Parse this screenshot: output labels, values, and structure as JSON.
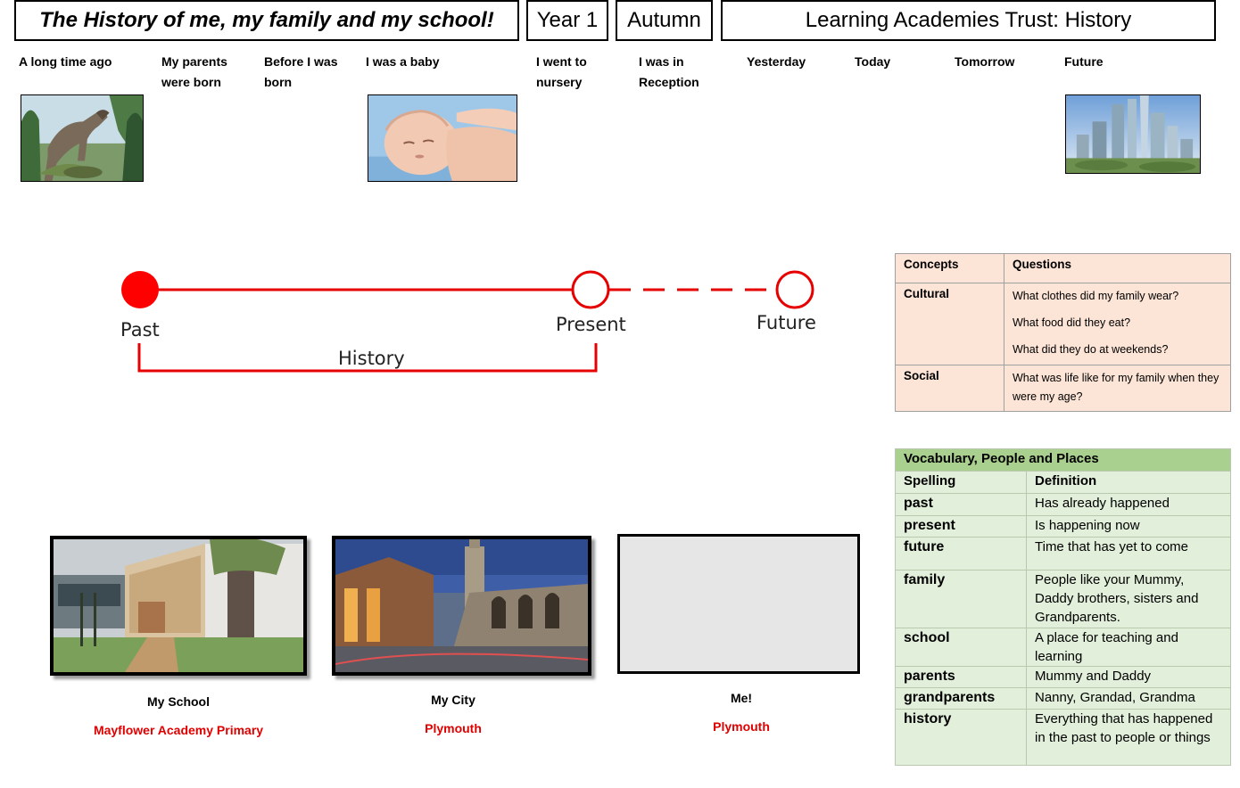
{
  "header": {
    "title": "The History of me, my family and my school!",
    "year": "Year 1",
    "term": "Autumn",
    "trust": "Learning Academies Trust:  History"
  },
  "timeline_labels": [
    [
      "A long time ago"
    ],
    [
      "My parents",
      "were born"
    ],
    [
      "Before I was",
      "born"
    ],
    [
      "I was a baby"
    ],
    [
      "I went to",
      "nursery"
    ],
    [
      "I was in",
      "Reception"
    ],
    [
      "Yesterday"
    ],
    [
      "Today"
    ],
    [
      "Tomorrow"
    ],
    [
      "Future"
    ]
  ],
  "images": {
    "dinosaur": "dinosaur-image",
    "baby": "baby-image",
    "future_city": "future-city-image"
  },
  "diagram": {
    "past": "Past",
    "present": "Present",
    "future": "Future",
    "history": "History",
    "line_color": "#e60000"
  },
  "concepts": {
    "header": [
      "Concepts",
      "Questions"
    ],
    "rows": [
      {
        "concept": "Cultural",
        "questions": [
          "What clothes did my family wear?",
          "What food did they eat?",
          "What did they do at weekends?"
        ]
      },
      {
        "concept": "Social",
        "questions": [
          "What was life like for my family when they were my age?"
        ]
      }
    ],
    "bg_color": "#fce4d6"
  },
  "vocab": {
    "title": "Vocabulary, People and Places",
    "header": [
      "Spelling",
      "Definition"
    ],
    "rows": [
      {
        "word": "past",
        "def": "Has already happened"
      },
      {
        "word": "present",
        "def": "Is happening now"
      },
      {
        "word": "future",
        "def": "Time that has yet to come"
      },
      {
        "word": "family",
        "def": "People like your Mummy, Daddy brothers, sisters and Grandparents."
      },
      {
        "word": "school",
        "def": "A place for teaching and learning"
      },
      {
        "word": "parents",
        "def": "Mummy and Daddy"
      },
      {
        "word": "grandparents",
        "def": "Nanny, Grandad, Grandma"
      },
      {
        "word": "history",
        "def": "Everything that has happened in the past to people or things"
      }
    ],
    "title_color": "#a9d08e",
    "bg_color": "#e2efda"
  },
  "photos": [
    {
      "caption": "My School",
      "sub": "Mayflower Academy Primary"
    },
    {
      "caption": "My City",
      "sub": "Plymouth"
    },
    {
      "caption": "Me!",
      "sub": "Plymouth"
    }
  ]
}
